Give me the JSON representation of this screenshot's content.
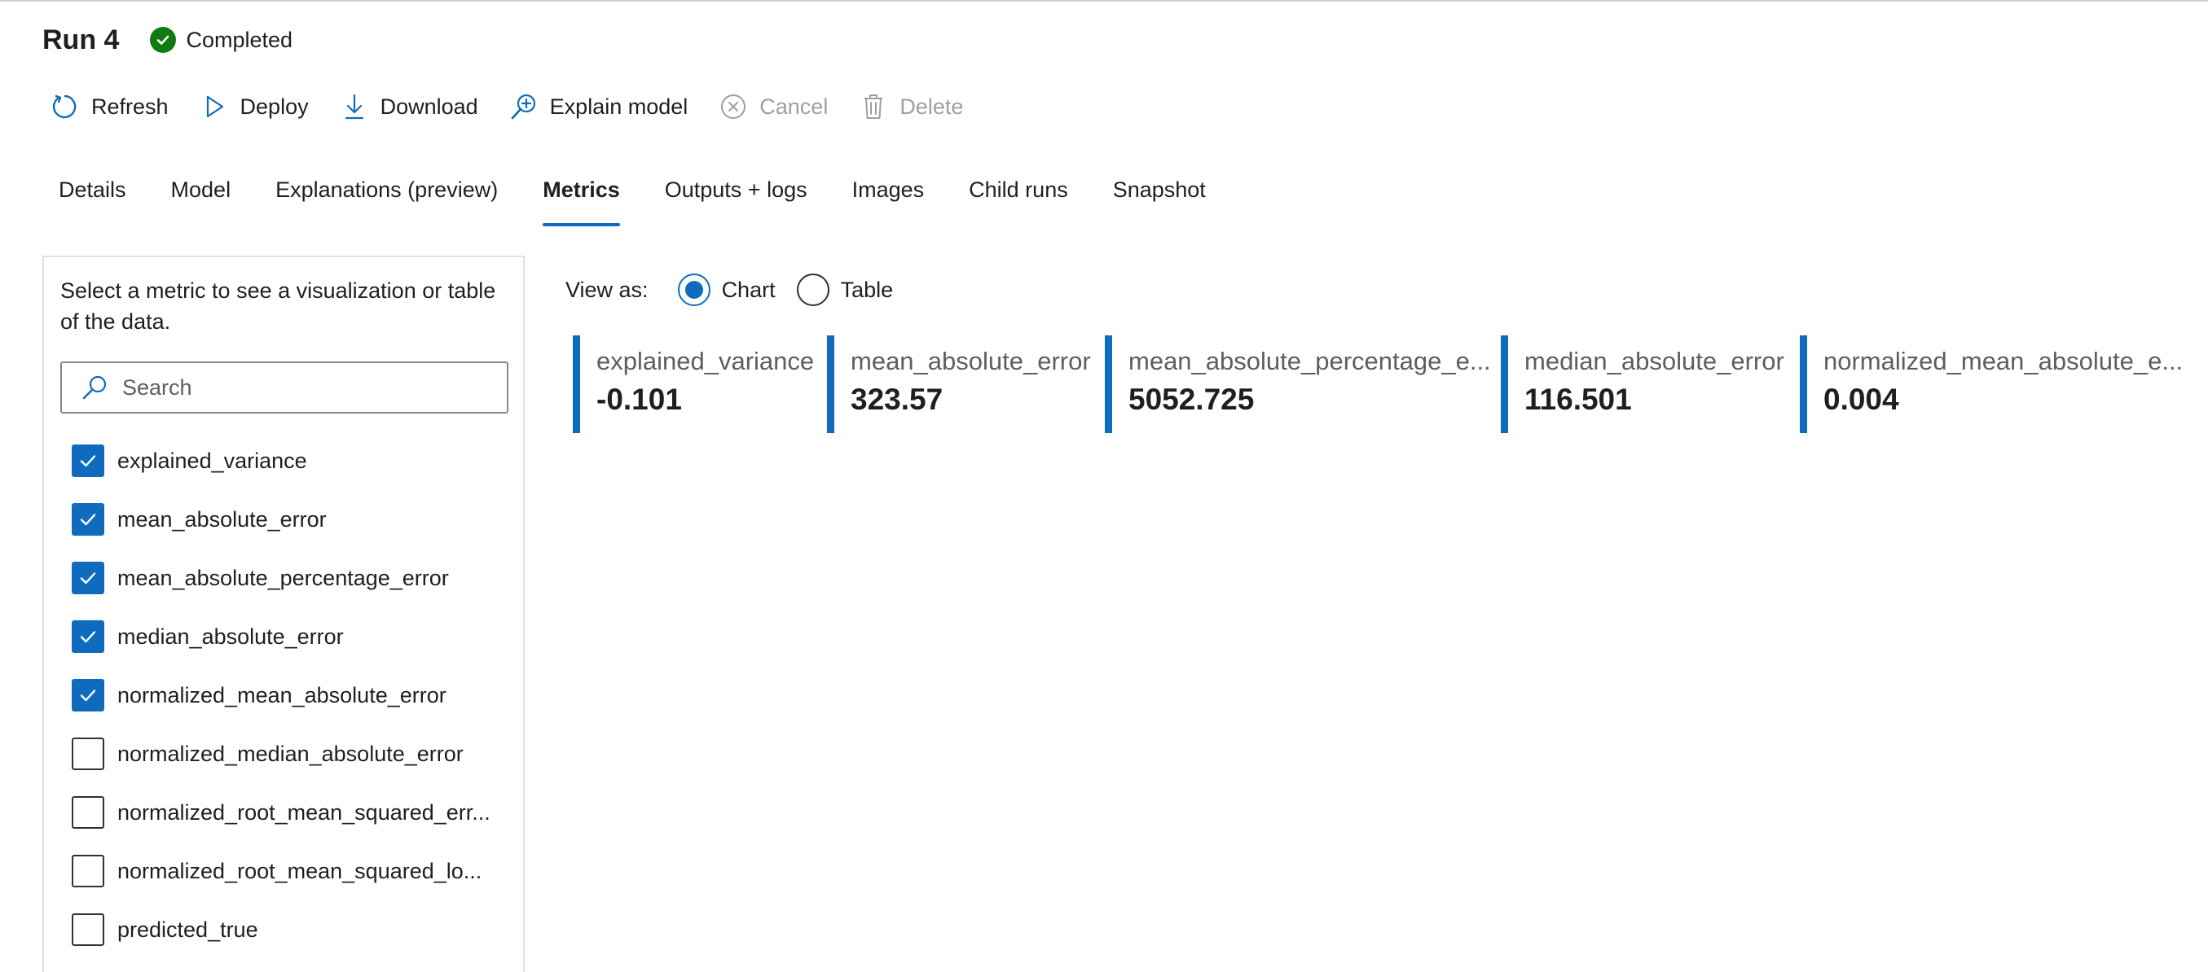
{
  "header": {
    "title": "Run 4",
    "status": "Completed"
  },
  "colors": {
    "accent": "#0f6cbd",
    "success": "#107c10",
    "disabled": "#a19f9d"
  },
  "toolbar": {
    "refresh": "Refresh",
    "deploy": "Deploy",
    "download": "Download",
    "explain": "Explain model",
    "cancel": "Cancel",
    "delete": "Delete"
  },
  "tabs": [
    {
      "label": "Details"
    },
    {
      "label": "Model"
    },
    {
      "label": "Explanations (preview)"
    },
    {
      "label": "Metrics",
      "active": true
    },
    {
      "label": "Outputs + logs"
    },
    {
      "label": "Images"
    },
    {
      "label": "Child runs"
    },
    {
      "label": "Snapshot"
    }
  ],
  "panel": {
    "description": "Select a metric to see a visualization or table of the data.",
    "search_placeholder": "Search"
  },
  "metrics": [
    {
      "label": "explained_variance",
      "checked": true
    },
    {
      "label": "mean_absolute_error",
      "checked": true
    },
    {
      "label": "mean_absolute_percentage_error",
      "checked": true
    },
    {
      "label": "median_absolute_error",
      "checked": true
    },
    {
      "label": "normalized_mean_absolute_error",
      "checked": true
    },
    {
      "label": "normalized_median_absolute_error",
      "checked": false
    },
    {
      "label": "normalized_root_mean_squared_err...",
      "checked": false
    },
    {
      "label": "normalized_root_mean_squared_lo...",
      "checked": false
    },
    {
      "label": "predicted_true",
      "checked": false
    }
  ],
  "view": {
    "label": "View as:",
    "chart": "Chart",
    "table": "Table",
    "selected": "Chart"
  },
  "cards": [
    {
      "name": "explained_variance",
      "value": "-0.101"
    },
    {
      "name": "mean_absolute_error",
      "value": "323.57"
    },
    {
      "name": "mean_absolute_percentage_e...",
      "value": "5052.725"
    },
    {
      "name": "median_absolute_error",
      "value": "116.501"
    },
    {
      "name": "normalized_mean_absolute_e...",
      "value": "0.004"
    }
  ]
}
